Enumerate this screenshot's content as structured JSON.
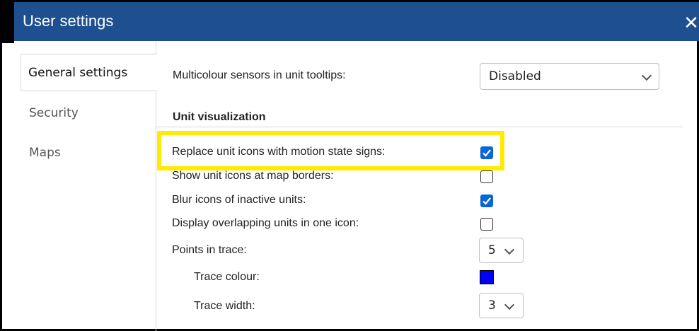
{
  "window": {
    "title": "User settings",
    "close_label": "✕"
  },
  "sidebar": {
    "items": [
      {
        "label": "General settings"
      },
      {
        "label": "Security"
      },
      {
        "label": "Maps"
      }
    ]
  },
  "general": {
    "multicolour_label": "Multicolour sensors in unit tooltips:",
    "multicolour_value": "Disabled",
    "section_title": "Unit visualization",
    "rows": {
      "replace_icons": {
        "label": "Replace unit icons with motion state signs:",
        "checked": true
      },
      "map_borders": {
        "label": "Show unit icons at map borders:",
        "checked": false
      },
      "blur_inactive": {
        "label": "Blur icons of inactive units:",
        "checked": true
      },
      "overlapping": {
        "label": "Display overlapping units in one icon:",
        "checked": false
      }
    },
    "points_label": "Points in trace:",
    "points_value": "5",
    "trace_colour_label": "Trace colour:",
    "trace_colour": "#0000ff",
    "trace_width_label": "Trace width:",
    "trace_width_value": "3"
  },
  "colors": {
    "titlebar": "#1e4f8f",
    "checkbox_on": "#0a66d6",
    "highlight": "#ffea00"
  }
}
